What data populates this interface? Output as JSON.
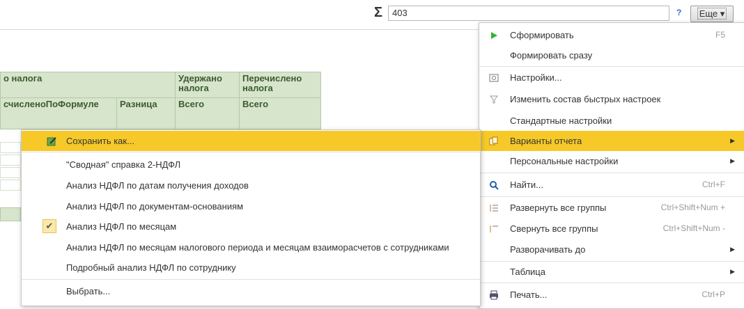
{
  "toolbar": {
    "sigma": "Σ",
    "sum_value": "403",
    "help": "?",
    "more": "Еще"
  },
  "table": {
    "h1": "о налога",
    "h2": "Удержано налога",
    "h3": "Перечислено налога",
    "s1": "счисленоПоФормуле",
    "s2": "Разница",
    "s3": "Всего",
    "s4": "Всего"
  },
  "main_menu": [
    {
      "label": "Сформировать",
      "shortcut": "F5",
      "icon": "play-icon"
    },
    {
      "label": "Формировать сразу",
      "shortcut": ""
    },
    {
      "label": "Настройки...",
      "shortcut": "",
      "icon": "settings-icon"
    },
    {
      "label": "Изменить состав быстрых настроек",
      "shortcut": "",
      "icon": "filter-icon"
    },
    {
      "label": "Стандартные настройки",
      "shortcut": ""
    },
    {
      "label": "Варианты отчета",
      "shortcut": "",
      "icon": "report-variants-icon"
    },
    {
      "label": "Персональные настройки",
      "shortcut": ""
    },
    {
      "label": "Найти...",
      "shortcut": "Ctrl+F",
      "icon": "search-icon"
    },
    {
      "label": "Развернуть все группы",
      "shortcut": "Ctrl+Shift+Num +",
      "icon": "expand-groups-icon"
    },
    {
      "label": "Свернуть все группы",
      "shortcut": "Ctrl+Shift+Num -",
      "icon": "collapse-groups-icon"
    },
    {
      "label": "Разворачивать до",
      "shortcut": ""
    },
    {
      "label": "Таблица",
      "shortcut": ""
    },
    {
      "label": "Печать...",
      "shortcut": "Ctrl+P",
      "icon": "print-icon"
    }
  ],
  "sub_menu": [
    {
      "label": "Сохранить как...",
      "icon": "save-as-icon"
    },
    {
      "label": "\"Сводная\" справка 2-НДФЛ"
    },
    {
      "label": "Анализ НДФЛ по датам получения доходов"
    },
    {
      "label": "Анализ НДФЛ по документам-основаниям"
    },
    {
      "label": "Анализ НДФЛ по месяцам",
      "checked": true
    },
    {
      "label": "Анализ НДФЛ по месяцам налогового периода и месяцам взаиморасчетов с сотрудниками"
    },
    {
      "label": "Подробный анализ НДФЛ по сотруднику"
    },
    {
      "label": "Выбрать..."
    }
  ],
  "colors": {
    "highlight": "#f6c928",
    "header_green": "#d6e5cb"
  }
}
